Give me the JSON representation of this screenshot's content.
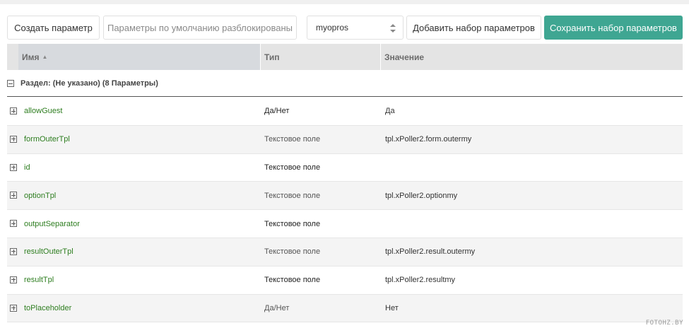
{
  "toolbar": {
    "create_param_label": "Создать параметр",
    "defaults_unlocked_label": "Параметры по умолчанию разблокированы",
    "set_select_value": "myopros",
    "add_set_label": "Добавить набор параметров",
    "save_set_label": "Сохранить набор параметров"
  },
  "grid": {
    "columns": {
      "name": "Имя",
      "type": "Тип",
      "value": "Значение"
    },
    "group_label": "Раздел: (Не указано) (8 Параметры)",
    "rows": [
      {
        "name": "allowGuest",
        "type": "Да/Нет",
        "value": "Да"
      },
      {
        "name": "formOuterTpl",
        "type": "Текстовое поле",
        "value": "tpl.xPoller2.form.outermy"
      },
      {
        "name": "id",
        "type": "Текстовое поле",
        "value": ""
      },
      {
        "name": "optionTpl",
        "type": "Текстовое поле",
        "value": "tpl.xPoller2.optionmy"
      },
      {
        "name": "outputSeparator",
        "type": "Текстовое поле",
        "value": ""
      },
      {
        "name": "resultOuterTpl",
        "type": "Текстовое поле",
        "value": "tpl.xPoller2.result.outermy"
      },
      {
        "name": "resultTpl",
        "type": "Текстовое поле",
        "value": "tpl.xPoller2.resultmy"
      },
      {
        "name": "toPlaceholder",
        "type": "Да/Нет",
        "value": "Нет"
      }
    ]
  },
  "colors": {
    "accent": "#3fa692",
    "name_text": "#2d7d1f",
    "yes": "#5aa03c",
    "no": "#b11a1a"
  },
  "watermark": "FOTOHZ.BY"
}
